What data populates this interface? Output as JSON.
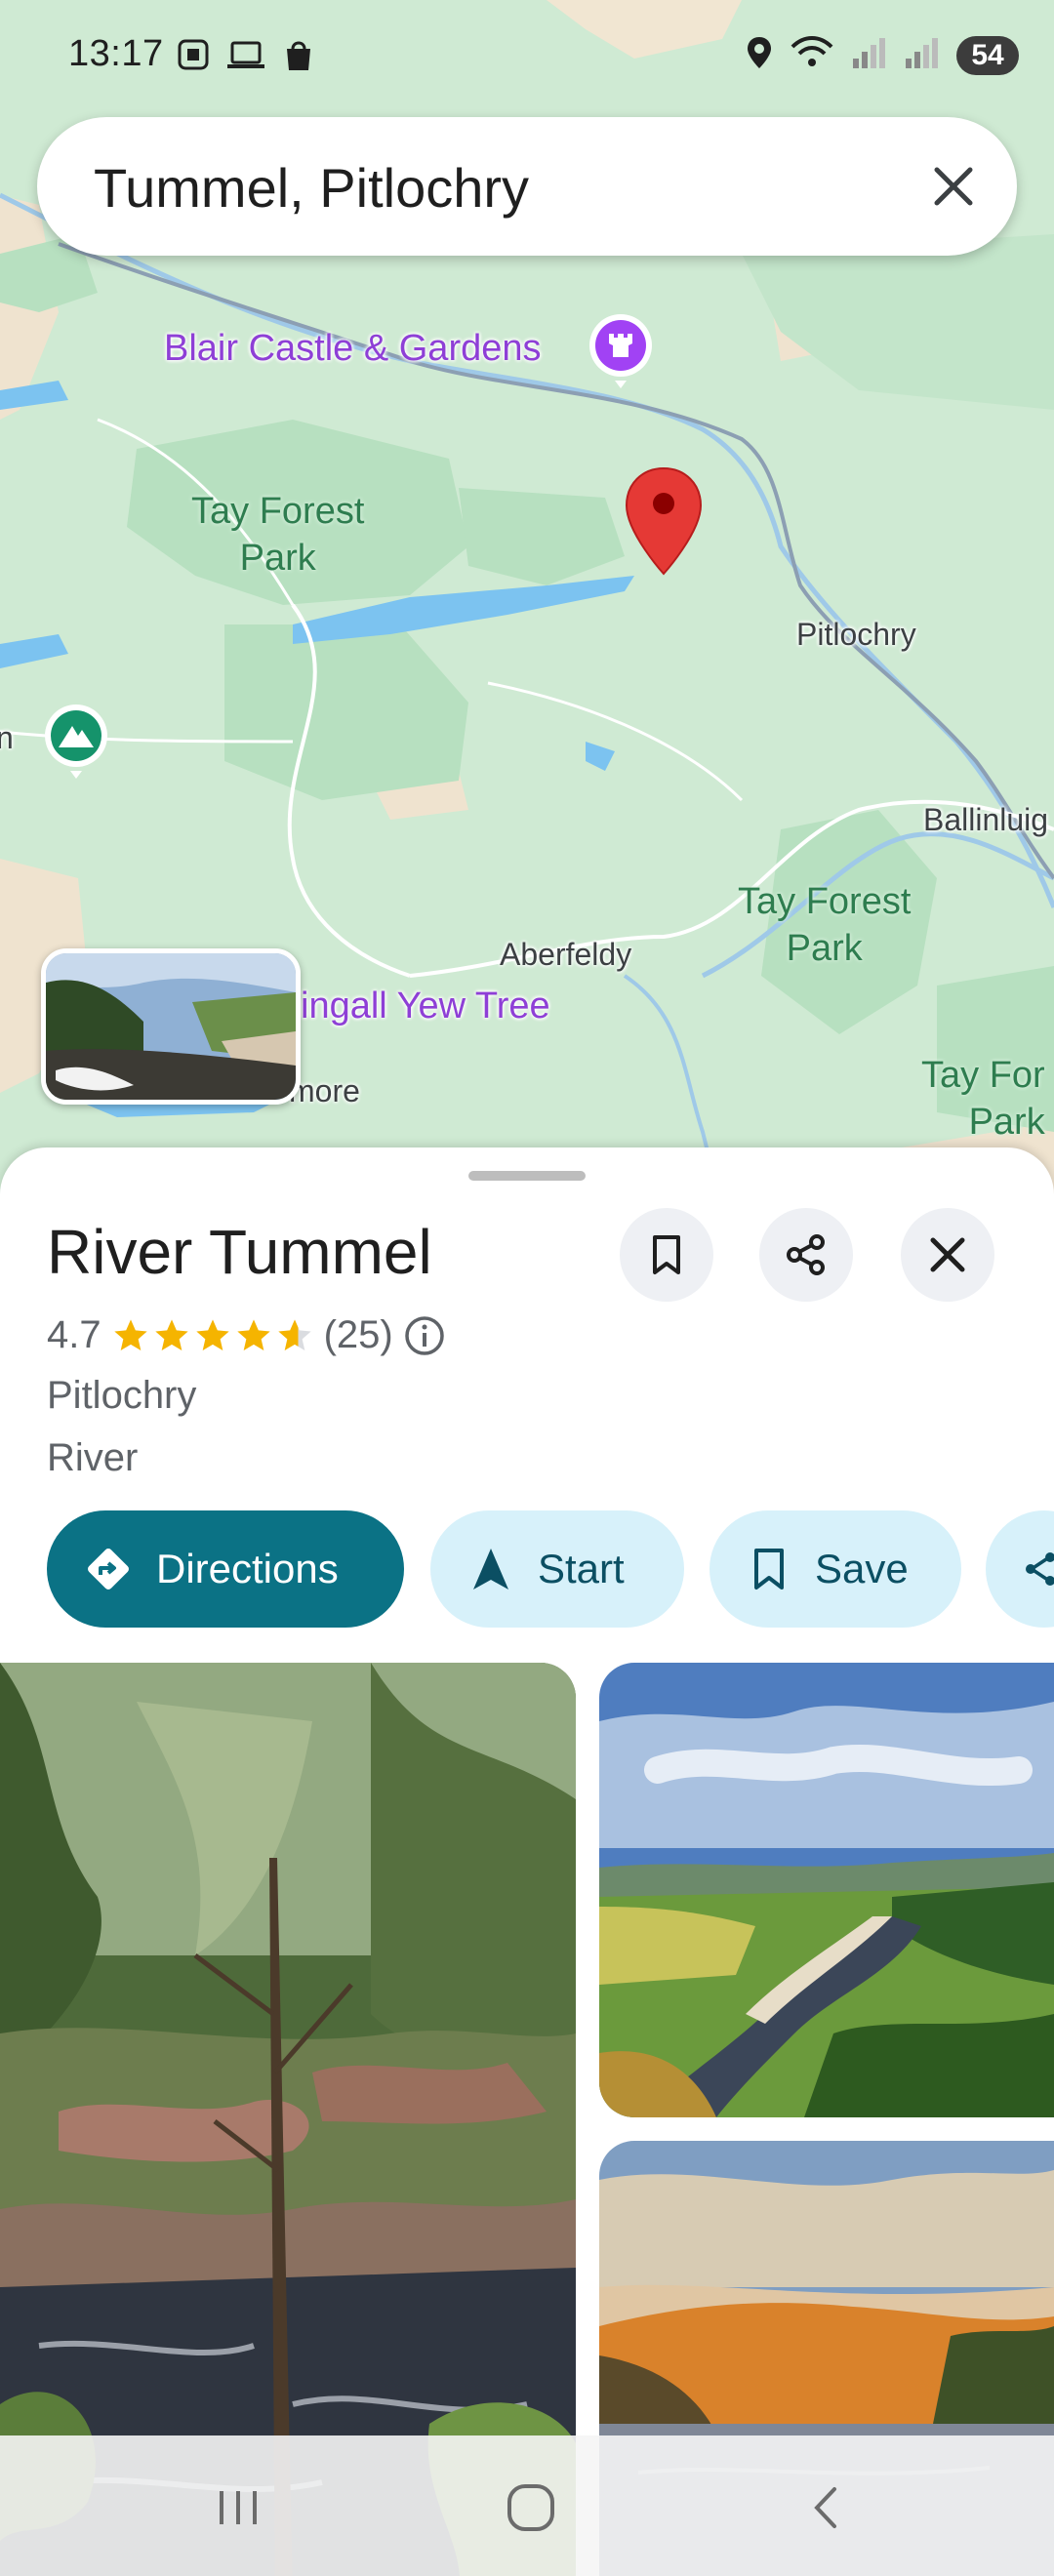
{
  "status_bar": {
    "time": "13:17",
    "battery": "54",
    "left_icons": [
      "screenshot-icon",
      "laptop-icon",
      "bag-icon"
    ],
    "right_icons": [
      "location-icon",
      "wifi-icon",
      "signal-icon",
      "signal-icon"
    ]
  },
  "search": {
    "query": "Tummel, Pitlochry"
  },
  "map": {
    "labels": {
      "blair_castle": "Blair Castle & Gardens",
      "tay_forest_park_1": "Tay Forest\nPark",
      "pitlochry": "Pitlochry",
      "ballinluig": "Ballinluig",
      "tay_forest_park_2": "Tay Forest\nPark",
      "aberfeldy": "Aberfeldy",
      "fortingall": "ingall Yew Tree",
      "kenmore": "more",
      "tay_forest_park_3": "Tay For\nPark",
      "left_partial": "n"
    }
  },
  "place": {
    "title": "River Tummel",
    "rating": "4.7",
    "rating_value": 4.7,
    "reviews": "(25)",
    "city": "Pitlochry",
    "type": "River"
  },
  "actions": {
    "directions": "Directions",
    "start": "Start",
    "save": "Save"
  },
  "colors": {
    "primary": "#0b7285",
    "tonal": "#d7f1fa",
    "star": "#f5b400",
    "pin": "#e53935",
    "poi": "#8e3fd6",
    "map_green": "#cbe9cf"
  }
}
